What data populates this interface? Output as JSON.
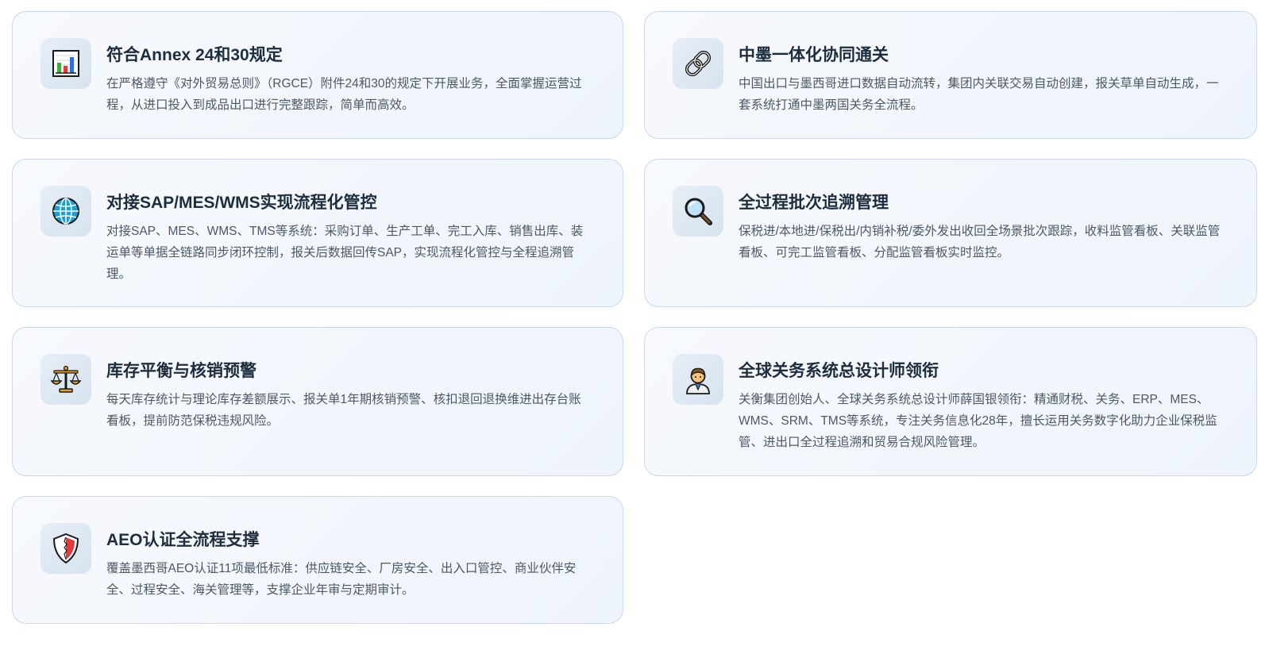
{
  "features": [
    {
      "title": "符合Annex 24和30规定",
      "description": "在严格遵守《对外贸易总则》（RGCE）附件24和30的规定下开展业务，全面掌握运营过程，从进口投入到成品出口进行完整跟踪，简单而高效。",
      "icon": "bar-chart-icon"
    },
    {
      "title": "中墨一体化协同通关",
      "description": "中国出口与墨西哥进口数据自动流转，集团内关联交易自动创建，报关草单自动生成，一套系统打通中墨两国关务全流程。",
      "icon": "link-icon"
    },
    {
      "title": "对接SAP/MES/WMS实现流程化管控",
      "description": "对接SAP、MES、WMS、TMS等系统：采购订单、生产工单、完工入库、销售出库、装运单等单据全链路同步闭环控制，报关后数据回传SAP，实现流程化管控与全程追溯管理。",
      "icon": "globe-icon"
    },
    {
      "title": "全过程批次追溯管理",
      "description": "保税进/本地进/保税出/内销补税/委外发出收回全场景批次跟踪，收料监管看板、关联监管看板、可完工监管看板、分配监管看板实时监控。",
      "icon": "magnifier-icon"
    },
    {
      "title": "库存平衡与核销预警",
      "description": "每天库存统计与理论库存差额展示、报关单1年期核销预警、核扣退回退换维进出存台账看板，提前防范保税违规风险。",
      "icon": "scales-icon"
    },
    {
      "title": "全球关务系统总设计师领衔",
      "description": "关衡集团创始人、全球关务系统总设计师薛国银领衔：精通财税、关务、ERP、MES、WMS、SRM、TMS等系统，专注关务信息化28年，擅长运用关务数字化助力企业保税监管、进出口全过程追溯和贸易合规风险管理。",
      "icon": "person-icon"
    },
    {
      "title": "AEO认证全流程支撑",
      "description": "覆盖墨西哥AEO认证11项最低标准：供应链安全、厂房安全、出入口管控、商业伙伴安全、过程安全、海关管理等，支撑企业年审与定期审计。",
      "icon": "shield-icon"
    }
  ]
}
